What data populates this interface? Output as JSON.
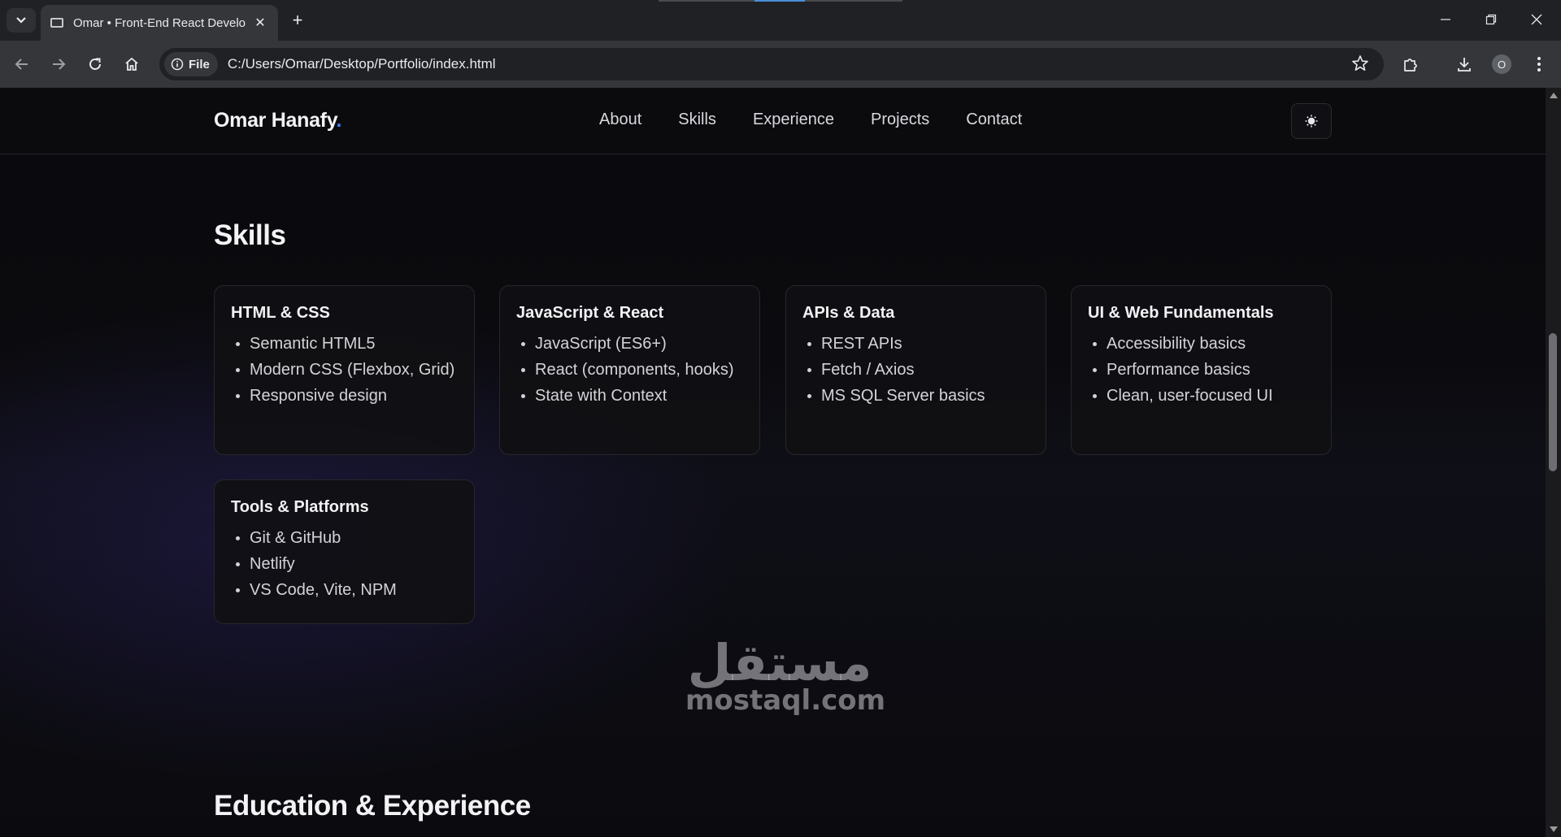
{
  "browser": {
    "tab_title": "Omar • Front-End React Developer",
    "file_chip": "File",
    "url": "C:/Users/Omar/Desktop/Portfolio/index.html",
    "profile_initial": "O"
  },
  "site": {
    "brand": "Omar Hanafy",
    "brand_dot": ".",
    "nav": [
      "About",
      "Skills",
      "Experience",
      "Projects",
      "Contact"
    ],
    "accent_color": "#3b82f6"
  },
  "skills": {
    "title": "Skills",
    "cards": [
      {
        "title": "HTML & CSS",
        "items": [
          "Semantic HTML5",
          "Modern CSS (Flexbox, Grid)",
          "Responsive design"
        ]
      },
      {
        "title": "JavaScript & React",
        "items": [
          "JavaScript (ES6+)",
          "React (components, hooks)",
          "State with Context"
        ]
      },
      {
        "title": "APIs & Data",
        "items": [
          "REST APIs",
          "Fetch / Axios",
          "MS SQL Server basics"
        ]
      },
      {
        "title": "UI & Web Fundamentals",
        "items": [
          "Accessibility basics",
          "Performance basics",
          "Clean, user-focused UI"
        ]
      },
      {
        "title": "Tools & Platforms",
        "items": [
          "Git & GitHub",
          "Netlify",
          "VS Code, Vite, NPM"
        ]
      }
    ]
  },
  "education": {
    "title": "Education & Experience"
  },
  "watermark": {
    "arabic": "مستقل",
    "latin": "mostaql.com"
  }
}
